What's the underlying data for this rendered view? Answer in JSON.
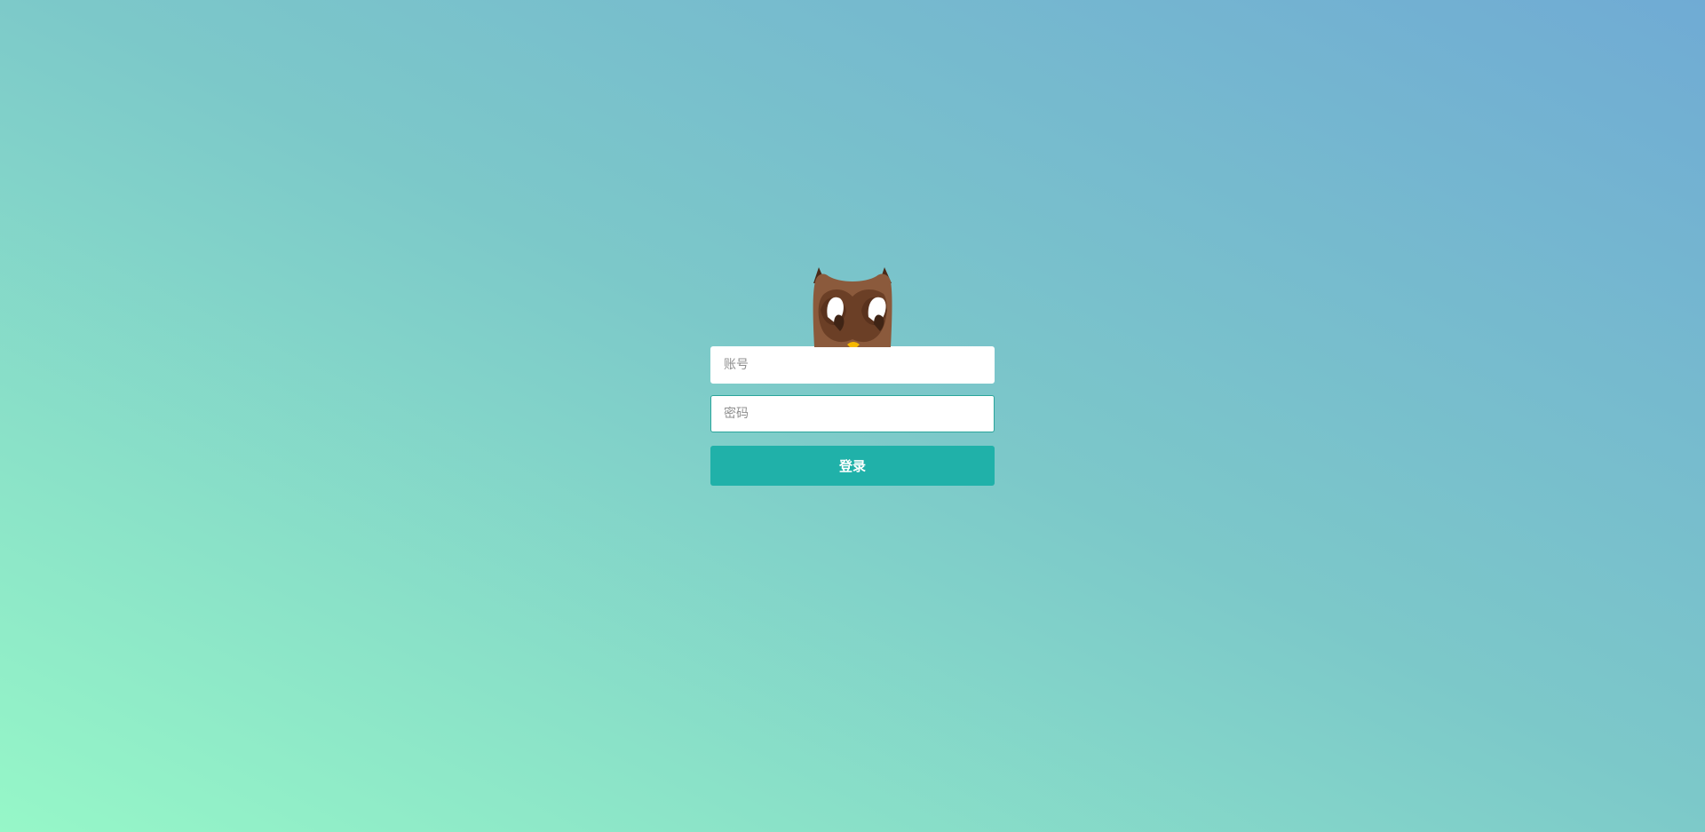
{
  "mascot": {
    "icon": "owl-mascot-icon",
    "colors": {
      "body": "#8b5a3c",
      "face": "#6b3f26",
      "eyes": "#ffffff",
      "beak": "#f5b800"
    }
  },
  "form": {
    "account_placeholder": "账号",
    "account_value": "",
    "password_placeholder": "密码",
    "password_value": "",
    "login_label": "登录"
  },
  "colors": {
    "button": "#20b1a9",
    "focus_border": "#2aa59b",
    "background_start": "#96f7c8",
    "background_end": "#70abd4"
  }
}
